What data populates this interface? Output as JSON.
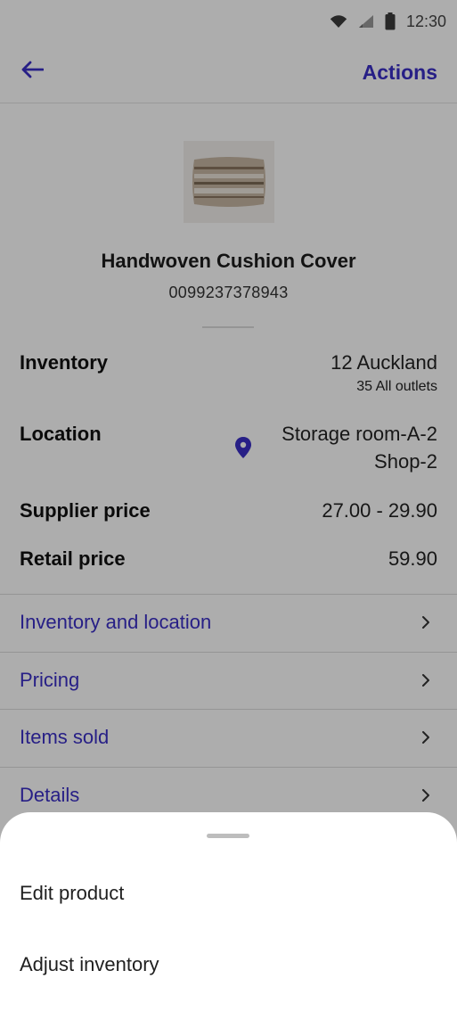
{
  "status_bar": {
    "time": "12:30",
    "icons": [
      "wifi-icon",
      "signal-icon",
      "battery-icon"
    ]
  },
  "app_bar": {
    "back_icon": "arrow-left-icon",
    "actions_label": "Actions"
  },
  "product": {
    "name": "Handwoven Cushion Cover",
    "barcode": "0099237378943"
  },
  "details": {
    "inventory": {
      "label": "Inventory",
      "value": "12 Auckland",
      "sub": "35 All outlets"
    },
    "location": {
      "label": "Location",
      "icon": "location-pin-icon",
      "value_1": "Storage room-A-2",
      "value_2": "Shop-2"
    },
    "supplier_price": {
      "label": "Supplier price",
      "value": "27.00 - 29.90"
    },
    "retail_price": {
      "label": "Retail price",
      "value": "59.90"
    }
  },
  "nav": {
    "items": [
      {
        "label": "Inventory and location"
      },
      {
        "label": "Pricing"
      },
      {
        "label": "Items sold"
      },
      {
        "label": "Details"
      }
    ]
  },
  "bottom_sheet": {
    "options": [
      {
        "label": "Edit product"
      },
      {
        "label": "Adjust inventory"
      }
    ]
  },
  "colors": {
    "accent": "#3a2fc6",
    "scrim": "rgba(0,0,0,0.32)",
    "text": "#1f1f1f",
    "divider": "#dcdcdc"
  }
}
